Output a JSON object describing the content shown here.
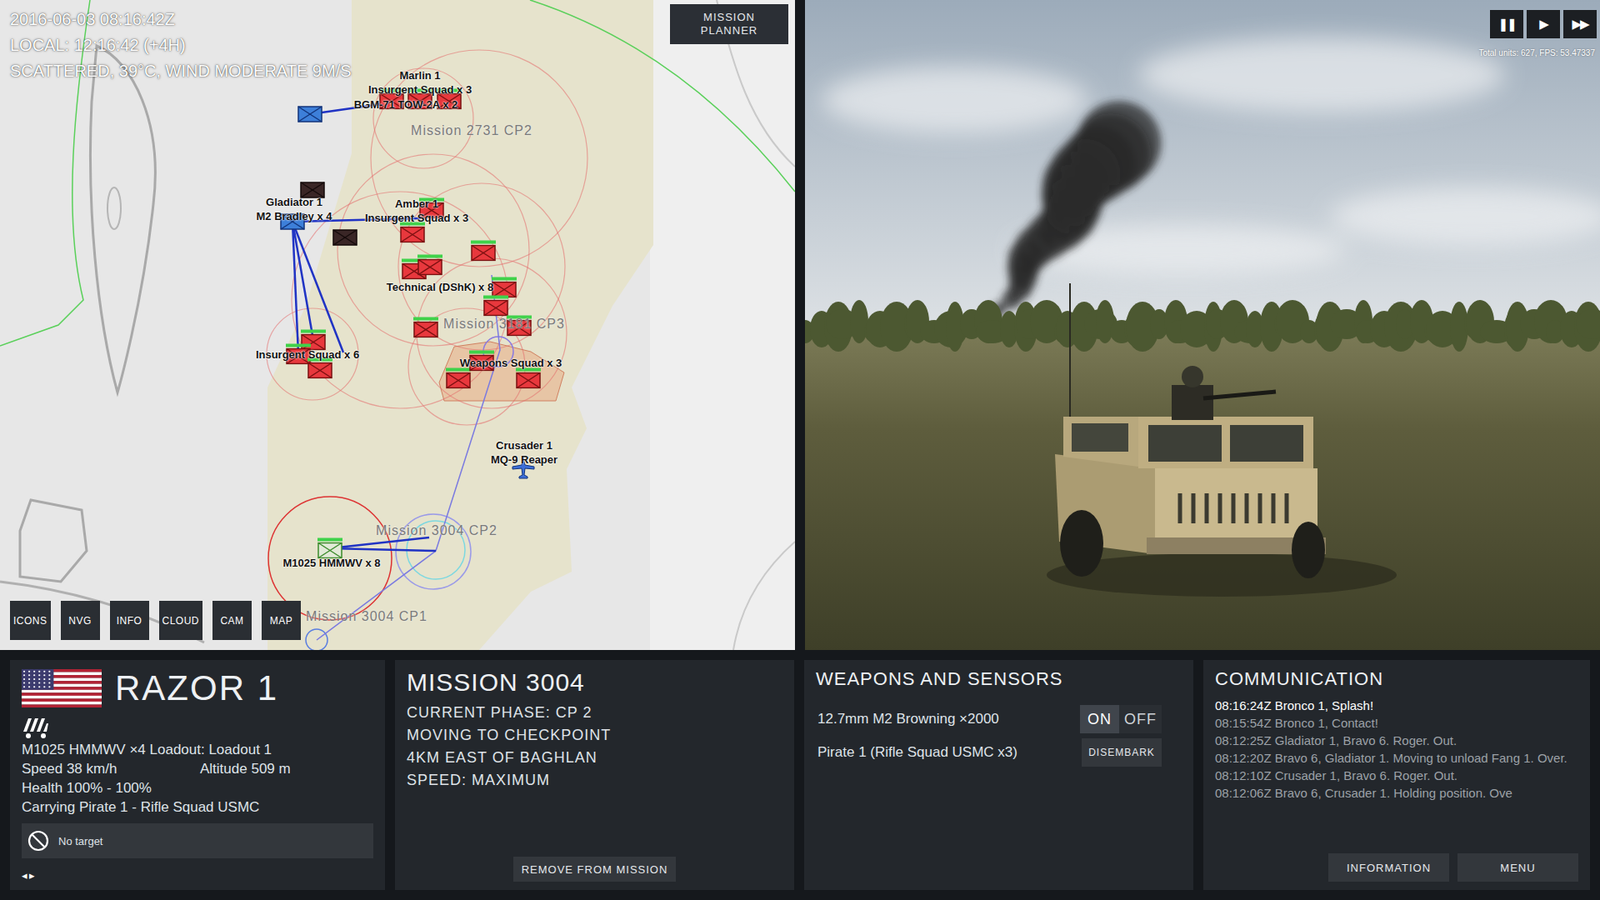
{
  "map": {
    "info": [
      "2016-06-03 08:16:42Z",
      "LOCAL: 12:16:42 (+4H)",
      "SCATTERED, 39°C, WIND MODERATE 9M/S"
    ],
    "planner_button": "MISSION PLANNER",
    "markers": [
      {
        "kind": "friendly"
      },
      {
        "kind": "hostile",
        "health": 1
      },
      {
        "kind": "hostile",
        "health": 1
      },
      {
        "kind": "hostile",
        "health": 1
      },
      {
        "kind": "destroyed"
      },
      {
        "kind": "friendly"
      },
      {
        "kind": "destroyed"
      },
      {
        "kind": "hostile",
        "health": 1
      },
      {
        "kind": "hostile",
        "health": 1
      },
      {
        "kind": "hostile",
        "health": 1
      },
      {
        "kind": "hostile",
        "health": 1
      },
      {
        "kind": "hostile",
        "health": 1
      },
      {
        "kind": "hostile",
        "health": 1
      },
      {
        "kind": "hostile",
        "health": 1
      },
      {
        "kind": "hostile",
        "health": 1
      },
      {
        "kind": "hostile",
        "health": 1
      },
      {
        "kind": "hostile",
        "health": 1
      },
      {
        "kind": "hostile",
        "health": 1
      },
      {
        "kind": "hostile",
        "health": 1
      },
      {
        "kind": "hostile",
        "health": 1
      },
      {
        "kind": "hostile",
        "health": 1
      },
      {
        "kind": "hostile",
        "health": 1
      },
      {
        "kind": "aircraft"
      },
      {
        "kind": "selected",
        "health": 1
      }
    ],
    "labels": [
      {
        "text": "Marlin 1",
        "kind": "unit"
      },
      {
        "text": "Insurgent Squad x 3",
        "kind": "unit"
      },
      {
        "text": "BGM-71 TOW-2A x 2",
        "kind": "unit"
      },
      {
        "text": "Mission 2731 CP2",
        "kind": "mission"
      },
      {
        "text": "Gladiator 1",
        "kind": "unit"
      },
      {
        "text": "M2 Bradley x 4",
        "kind": "unit"
      },
      {
        "text": "Amber 1",
        "kind": "unit"
      },
      {
        "text": "Insurgent Squad x 3",
        "kind": "unit"
      },
      {
        "text": "Technical (DShK) x 8",
        "kind": "unit"
      },
      {
        "text": "Mission 3181 CP3",
        "kind": "mission"
      },
      {
        "text": "Insurgent Squad x 6",
        "kind": "unit"
      },
      {
        "text": "Weapons Squad x 3",
        "kind": "unit"
      },
      {
        "text": "Crusader 1",
        "kind": "unit"
      },
      {
        "text": "MQ-9 Reaper",
        "kind": "unit"
      },
      {
        "text": "Mission 3004 CP2",
        "kind": "mission"
      },
      {
        "text": "M1025 HMMWV x 8",
        "kind": "unit"
      },
      {
        "text": "Mission 3004 CP1",
        "kind": "mission"
      }
    ],
    "buttons": [
      "ICONS",
      "NVG",
      "INFO",
      "CLOUD",
      "CAM",
      "MAP"
    ]
  },
  "sim": {
    "controls": [
      "❚❚",
      "▶",
      "▶▶"
    ],
    "stats": "Total units: 627, FPS: 53.47337"
  },
  "unit": {
    "name": "RAZOR 1",
    "details": "M1025 HMMWV ×4 Loadout: Loadout 1",
    "speed": "Speed 38 km/h",
    "altitude": "Altitude 509 m",
    "health": "Health 100% - 100%",
    "carrying": "Carrying Pirate 1 - Rifle Squad USMC",
    "target": "No target",
    "pager": [
      "◂",
      "▸"
    ]
  },
  "mission": {
    "title": "MISSION 3004",
    "lines": [
      "CURRENT PHASE: CP 2",
      "MOVING TO CHECKPOINT",
      "4KM EAST OF BAGHLAN",
      "SPEED: MAXIMUM"
    ],
    "button": "REMOVE FROM MISSION"
  },
  "weapons": {
    "title": "WEAPONS AND SENSORS",
    "weapon": "12.7mm M2 Browning ×2000",
    "toggle": [
      {
        "label": "ON",
        "selected": true
      },
      {
        "label": "OFF",
        "selected": false
      }
    ],
    "cargo": "Pirate 1 (Rifle Squad USMC x3)",
    "cargo_button": "DISEMBARK"
  },
  "communication": {
    "title": "COMMUNICATION",
    "messages": [
      {
        "text": "08:16:24Z Bronco 1, Splash!",
        "new": true
      },
      {
        "text": "08:15:54Z Bronco 1, Contact!",
        "new": false
      },
      {
        "text": "08:12:25Z Gladiator 1, Bravo 6. Roger. Out.",
        "new": false
      },
      {
        "text": "08:12:20Z Bravo 6, Gladiator 1. Moving to unload Fang 1. Over.",
        "new": false
      },
      {
        "text": "08:12:10Z Crusader 1, Bravo 6. Roger. Out.",
        "new": false
      },
      {
        "text": "08:12:06Z Bravo 6, Crusader 1. Holding position. Ove",
        "new": false
      }
    ],
    "buttons": [
      "INFORMATION",
      "MENU"
    ]
  }
}
